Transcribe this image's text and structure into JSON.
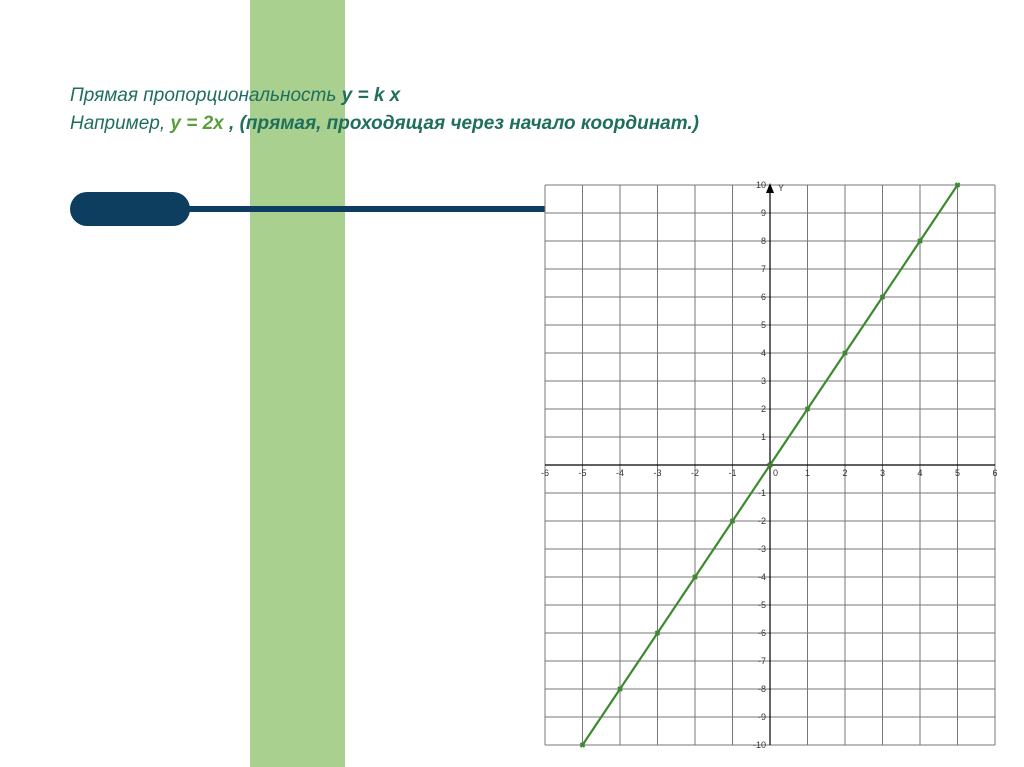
{
  "title": {
    "line1_prefix": "Прямая пропорциональность    ",
    "line1_eq": "y = k x",
    "line2_prefix": "Например,  ",
    "line2_eq": "y = 2x  ",
    "line2_suffix": ", (прямая, проходящая через начало  координат.)"
  },
  "chart_data": {
    "type": "line",
    "title": "",
    "xlabel": "",
    "ylabel": "Y",
    "xlim": [
      -6,
      6
    ],
    "ylim": [
      -10,
      10
    ],
    "x_ticks": [
      -6,
      -5,
      -4,
      -3,
      -2,
      -1,
      0,
      1,
      2,
      3,
      4,
      5,
      6
    ],
    "y_ticks": [
      -10,
      -9,
      -8,
      -7,
      -6,
      -5,
      -4,
      -3,
      -2,
      -1,
      0,
      1,
      2,
      3,
      4,
      5,
      6,
      7,
      8,
      9,
      10
    ],
    "series": [
      {
        "name": "y = 2x",
        "x": [
          -5,
          -4,
          -3,
          -2,
          -1,
          0,
          1,
          2,
          3,
          4,
          5
        ],
        "values": [
          -10,
          -8,
          -6,
          -4,
          -2,
          0,
          2,
          4,
          6,
          8,
          10
        ],
        "color": "#3c8a2e"
      }
    ],
    "grid": true
  }
}
